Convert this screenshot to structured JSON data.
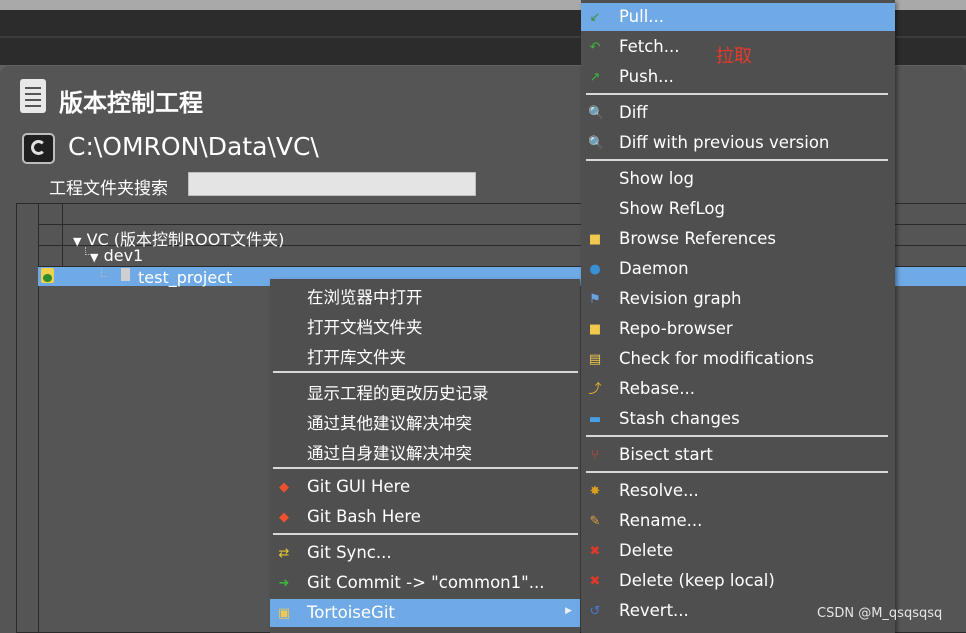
{
  "window": {
    "title": "版本控制工程",
    "path": "C:\\OMRON\\Data\\VC\\"
  },
  "search": {
    "label": "工程文件夹搜索",
    "value": ""
  },
  "tree": {
    "root_label": "VC (版本控制ROOT文件夹)",
    "branch_label": "dev1",
    "project_label": "test_project"
  },
  "context_menu": {
    "items": [
      {
        "label": "在浏览器中打开",
        "icon": ""
      },
      {
        "label": "打开文档文件夹",
        "icon": ""
      },
      {
        "label": "打开库文件夹",
        "icon": ""
      },
      {
        "label": "显示工程的更改历史记录",
        "icon": ""
      },
      {
        "label": "通过其他建议解决冲突",
        "icon": ""
      },
      {
        "label": "通过自身建议解决冲突",
        "icon": ""
      },
      {
        "label": "Git GUI Here",
        "icon": "git-icon"
      },
      {
        "label": "Git Bash Here",
        "icon": "git-icon"
      },
      {
        "label": "Git Sync...",
        "icon": "sync-icon"
      },
      {
        "label": "Git Commit -> \"common1\"...",
        "icon": "commit-icon"
      },
      {
        "label": "TortoiseGit",
        "icon": "tortoisegit-icon"
      }
    ]
  },
  "submenu": {
    "items": [
      {
        "label": "Pull...",
        "icon": "pull-icon"
      },
      {
        "label": "Fetch...",
        "icon": "fetch-icon"
      },
      {
        "label": "Push...",
        "icon": "push-icon"
      },
      {
        "label": "Diff",
        "icon": "diff-icon"
      },
      {
        "label": "Diff with previous version",
        "icon": "diff-icon"
      },
      {
        "label": "Show log",
        "icon": ""
      },
      {
        "label": "Show RefLog",
        "icon": ""
      },
      {
        "label": "Browse References",
        "icon": "references-icon"
      },
      {
        "label": "Daemon",
        "icon": "daemon-icon"
      },
      {
        "label": "Revision graph",
        "icon": "revision-graph-icon"
      },
      {
        "label": "Repo-browser",
        "icon": "repo-browser-icon"
      },
      {
        "label": "Check for modifications",
        "icon": "check-modifications-icon"
      },
      {
        "label": "Rebase...",
        "icon": "rebase-icon"
      },
      {
        "label": "Stash changes",
        "icon": "stash-icon"
      },
      {
        "label": "Bisect start",
        "icon": "bisect-icon"
      },
      {
        "label": "Resolve...",
        "icon": "resolve-icon"
      },
      {
        "label": "Rename...",
        "icon": "rename-icon"
      },
      {
        "label": "Delete",
        "icon": "delete-icon"
      },
      {
        "label": "Delete (keep local)",
        "icon": "delete-icon"
      },
      {
        "label": "Revert...",
        "icon": "revert-icon"
      }
    ]
  },
  "annotation": "拉取",
  "watermark": "CSDN @M_qsqsqsq",
  "colors": {
    "highlight": "#6fa9e6",
    "annotation": "#e83a2c"
  }
}
